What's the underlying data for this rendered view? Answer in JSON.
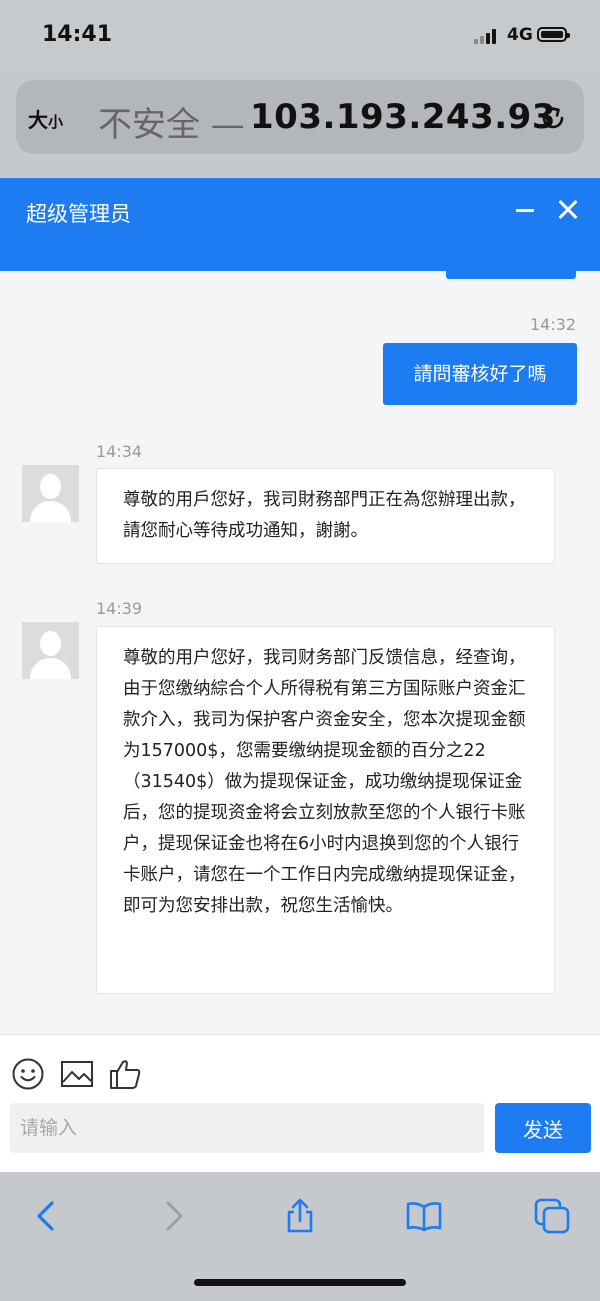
{
  "status_bar": {
    "time": "14:41",
    "network": "4G"
  },
  "address_bar": {
    "size_label": "大",
    "size_label_small": "小",
    "insecure_label": "不安全 —",
    "host": "103.193.243.93"
  },
  "chat_header": {
    "title": "超级管理员"
  },
  "messages": [
    {
      "time": "14:32",
      "text": "請問審核好了嗎"
    },
    {
      "time": "14:34",
      "text": "尊敬的用戶您好，我司財務部門正在為您辦理出款，請您耐心等待成功通知，謝謝。"
    },
    {
      "time": "14:39",
      "text": "尊敬的用户您好，我司财务部门反馈信息，经查询，由于您缴纳綜合个人所得税有第三方国际账户资金汇款介入，我司为保护客户资金安全，您本次提现金额为157000$，您需要缴纳提现金额的百分之22（31540$）做为提现保证金，成功缴纳提现保证金后，您的提现资金将会立刻放款至您的个人银行卡账户，提现保证金也将在6小时内退换到您的个人银行卡账户，请您在一个工作日内完成缴纳提现保证金，即可为您安排出款，祝您生活愉快。"
    }
  ],
  "composer": {
    "placeholder": "请输入",
    "send_label": "发送"
  },
  "colors": {
    "accent": "#1e7cf2",
    "chat_bg": "#f4f5f6"
  }
}
